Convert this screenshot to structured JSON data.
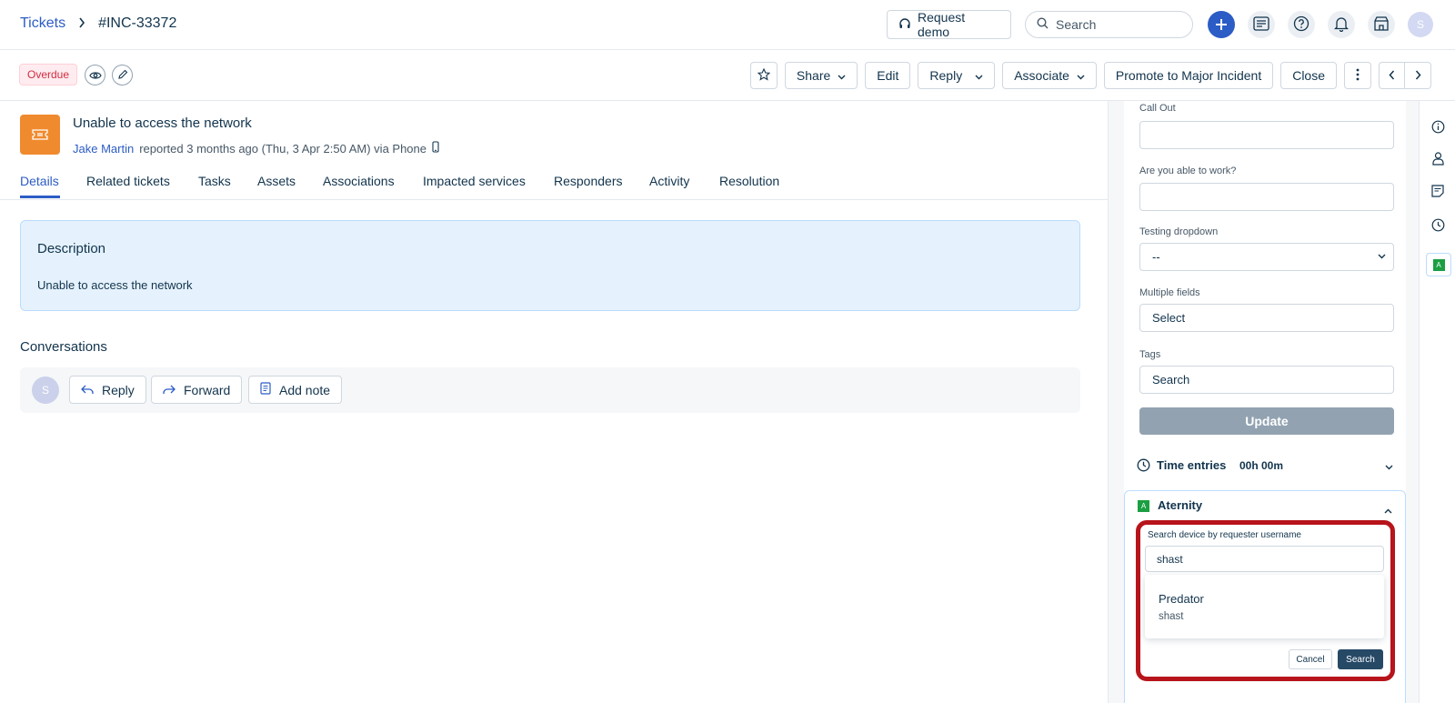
{
  "breadcrumb": {
    "root": "Tickets",
    "separator": ">",
    "current": "#INC-33372"
  },
  "topbar": {
    "request_demo": "Request demo",
    "search_placeholder": "Search",
    "avatar_initial": "S"
  },
  "toolbar": {
    "status_badge": "Overdue",
    "share": "Share",
    "edit": "Edit",
    "reply": "Reply",
    "associate": "Associate",
    "promote": "Promote to Major Incident",
    "close": "Close"
  },
  "ticket": {
    "title": "Unable to access the network",
    "requester": "Jake Martin",
    "reported": "reported 3 months ago (Thu, 3 Apr 2:50 AM) via Phone"
  },
  "tabs": [
    "Details",
    "Related tickets",
    "Tasks",
    "Assets",
    "Associations",
    "Impacted services",
    "Responders",
    "Activity",
    "Resolution"
  ],
  "description": {
    "title": "Description",
    "body": "Unable to access the network"
  },
  "conversations": {
    "title": "Conversations",
    "avatar_initial": "S",
    "reply": "Reply",
    "forward": "Forward",
    "add_note": "Add note"
  },
  "properties": {
    "callout_label": "Call Out",
    "able_to_work_label": "Are you able to work?",
    "testing_dropdown_label": "Testing dropdown",
    "testing_dropdown_value": "--",
    "multiple_fields_label": "Multiple fields",
    "multiple_fields_value": "Select",
    "tags_label": "Tags",
    "tags_placeholder": "Search",
    "update": "Update"
  },
  "time_entries": {
    "label": "Time entries",
    "value": "00h 00m"
  },
  "aternity": {
    "title": "Aternity",
    "logo_letter": "A",
    "search_label": "Search device by requester username",
    "search_value": "shast",
    "result_name": "Predator",
    "result_user": "shast",
    "cancel": "Cancel",
    "search": "Search"
  },
  "far_right": {
    "active_letter": "A"
  }
}
